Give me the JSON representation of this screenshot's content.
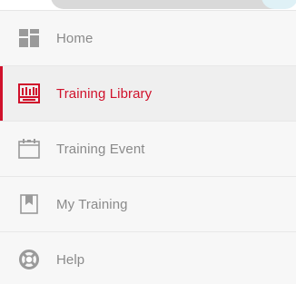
{
  "colors": {
    "accent": "#d0112b",
    "inactive_text": "#8a8a8a",
    "inactive_icon": "#9a9a9a"
  },
  "nav": {
    "items": [
      {
        "label": "Home",
        "icon": "home-grid-icon",
        "active": false
      },
      {
        "label": "Training Library",
        "icon": "library-icon",
        "active": true
      },
      {
        "label": "Training Event",
        "icon": "calendar-icon",
        "active": false
      },
      {
        "label": "My Training",
        "icon": "bookmark-icon",
        "active": false
      },
      {
        "label": "Help",
        "icon": "lifebuoy-icon",
        "active": false
      }
    ]
  }
}
